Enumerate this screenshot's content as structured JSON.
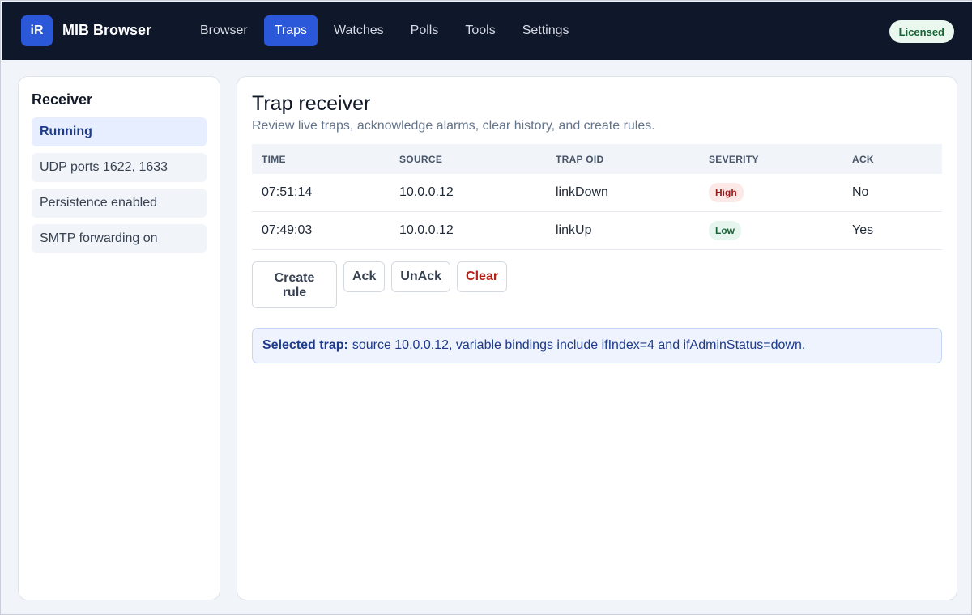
{
  "app": {
    "logo_text": "iR",
    "title": "MIB Browser",
    "license_badge": "Licensed"
  },
  "nav": {
    "items": [
      {
        "label": "Browser"
      },
      {
        "label": "Traps",
        "active": true
      },
      {
        "label": "Watches"
      },
      {
        "label": "Polls"
      },
      {
        "label": "Tools"
      },
      {
        "label": "Settings"
      }
    ]
  },
  "sidebar": {
    "title": "Receiver",
    "items": [
      {
        "label": "Running",
        "active": true
      },
      {
        "label": "UDP ports 1622, 1633"
      },
      {
        "label": "Persistence enabled"
      },
      {
        "label": "SMTP forwarding on"
      }
    ]
  },
  "main": {
    "title": "Trap receiver",
    "subtitle": "Review live traps, acknowledge alarms, clear history, and create rules.",
    "table": {
      "headers": [
        "TIME",
        "SOURCE",
        "TRAP OID",
        "SEVERITY",
        "ACK"
      ],
      "rows": [
        {
          "time": "07:51:14",
          "source": "10.0.0.12",
          "oid": "linkDown",
          "severity": "High",
          "ack": "No"
        },
        {
          "time": "07:49:03",
          "source": "10.0.0.12",
          "oid": "linkUp",
          "severity": "Low",
          "ack": "Yes"
        }
      ]
    },
    "actions": {
      "create_rule": "Create rule",
      "ack": "Ack",
      "unack": "UnAck",
      "clear": "Clear"
    },
    "notice": {
      "label": "Selected trap:",
      "text": "source 10.0.0.12, variable bindings include ifIndex=4 and ifAdminStatus=down."
    }
  },
  "colors": {
    "header_bg": "#0f172a",
    "accent": "#2b57d9",
    "danger": "#b42318",
    "success": "#166534"
  }
}
